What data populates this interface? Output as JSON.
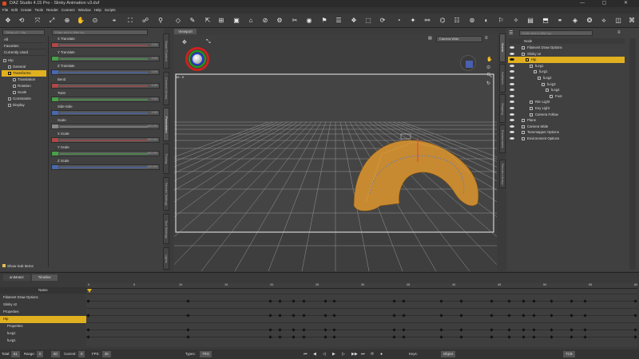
{
  "window": {
    "title": "DAZ Studio 4.15 Pro - Slinky Animation v3.duf"
  },
  "menu": [
    "File",
    "Edit",
    "Create",
    "Tools",
    "Render",
    "Connect",
    "Window",
    "Help",
    "Scripts"
  ],
  "left": {
    "scene_selector": "Slinky v2 : Hip",
    "categories": [
      "All",
      "Favorites",
      "Currently Used"
    ],
    "tree": [
      {
        "label": "Hip",
        "indent": 0
      },
      {
        "label": "General",
        "indent": 1
      },
      {
        "label": "Transforms",
        "indent": 1,
        "selected": true
      },
      {
        "label": "Translation",
        "indent": 2
      },
      {
        "label": "Rotation",
        "indent": 2
      },
      {
        "label": "Scale",
        "indent": 2
      },
      {
        "label": "Constraints",
        "indent": 1
      },
      {
        "label": "Display",
        "indent": 1
      }
    ],
    "show_sub_items": "Show Sub Items",
    "search_placeholder": "Enter text to filter by..."
  },
  "properties": [
    {
      "label": "X Translate",
      "value": "0.00",
      "color": "#b04848"
    },
    {
      "label": "Y Translate",
      "value": "0.00",
      "color": "#48a048"
    },
    {
      "label": "Z Translate",
      "value": "0.00",
      "color": "#4868b0"
    },
    {
      "label": "Bend",
      "value": "0.00",
      "color": "#b04848"
    },
    {
      "label": "Twist",
      "value": "0.00",
      "color": "#48a048"
    },
    {
      "label": "Side-Side",
      "value": "0.00",
      "color": "#4868b0"
    },
    {
      "label": "Scale",
      "value": "100.0%",
      "color": "#888888"
    },
    {
      "label": "X Scale",
      "value": "100.0%",
      "color": "#b04848"
    },
    {
      "label": "Y Scale",
      "value": "100.0%",
      "color": "#48a048"
    },
    {
      "label": "Z Scale",
      "value": "100.0%",
      "color": "#4868b0"
    }
  ],
  "side_tabs_left": [
    "Smart Content",
    "Content Library",
    "Parameters",
    "Posing",
    "Render Settings",
    "Tool Settings",
    "Lights"
  ],
  "viewport": {
    "tab": "Viewport",
    "camera": "Camera Wide",
    "aspect": "16 : 9"
  },
  "scene": {
    "search_placeholder": "Enter text to filter by...",
    "header": "Node",
    "rows": [
      {
        "label": "Filament Draw Options",
        "indent": 0
      },
      {
        "label": "Slinky v2",
        "indent": 0
      },
      {
        "label": "Hip",
        "indent": 1,
        "selected": true
      },
      {
        "label": "lLeg1",
        "indent": 2
      },
      {
        "label": "lLeg1",
        "indent": 3
      },
      {
        "label": "lLeg2",
        "indent": 4
      },
      {
        "label": "lLeg3",
        "indent": 5
      },
      {
        "label": "lLeg4",
        "indent": 6
      },
      {
        "label": "Foot",
        "indent": 7
      },
      {
        "label": "Rim Light",
        "indent": 2
      },
      {
        "label": "Key Light",
        "indent": 2
      },
      {
        "label": "Camera Follow",
        "indent": 2
      },
      {
        "label": "Plane",
        "indent": 0
      },
      {
        "label": "Camera Wide",
        "indent": 0
      },
      {
        "label": "Tonemapper Options",
        "indent": 0
      },
      {
        "label": "Environment Options",
        "indent": 0
      }
    ]
  },
  "side_tabs_right": [
    "Scene",
    "Surfaces",
    "Shaping",
    "Environment",
    "Render Library"
  ],
  "timeline": {
    "tabs": [
      "aniMate2",
      "Timeline"
    ],
    "name_header": "Name",
    "rows": [
      {
        "label": "Filament Draw Options",
        "indent": 0
      },
      {
        "label": "Slinky v2",
        "indent": 0
      },
      {
        "label": "Properties",
        "indent": 0
      },
      {
        "label": "Hip",
        "indent": 0,
        "selected": true
      },
      {
        "label": "Properties",
        "indent": 1
      },
      {
        "label": "lLeg1",
        "indent": 1
      },
      {
        "label": "lLeg1",
        "indent": 1
      }
    ],
    "ticks": [
      "0",
      "5",
      "10",
      "15",
      "20",
      "25",
      "30",
      "35",
      "40",
      "45",
      "50",
      "55",
      "60"
    ]
  },
  "bottom": {
    "total_label": "Total:",
    "total": "61",
    "range_label": "Range:",
    "range_start": "0",
    "range_end": "60",
    "current_label": "Current:",
    "current": "0",
    "fps_label": "FPS:",
    "fps": "30",
    "types_label": "Types:",
    "types": "TRO",
    "keys_label": "Keys:",
    "keys": "Object",
    "tcb": "TCB"
  }
}
